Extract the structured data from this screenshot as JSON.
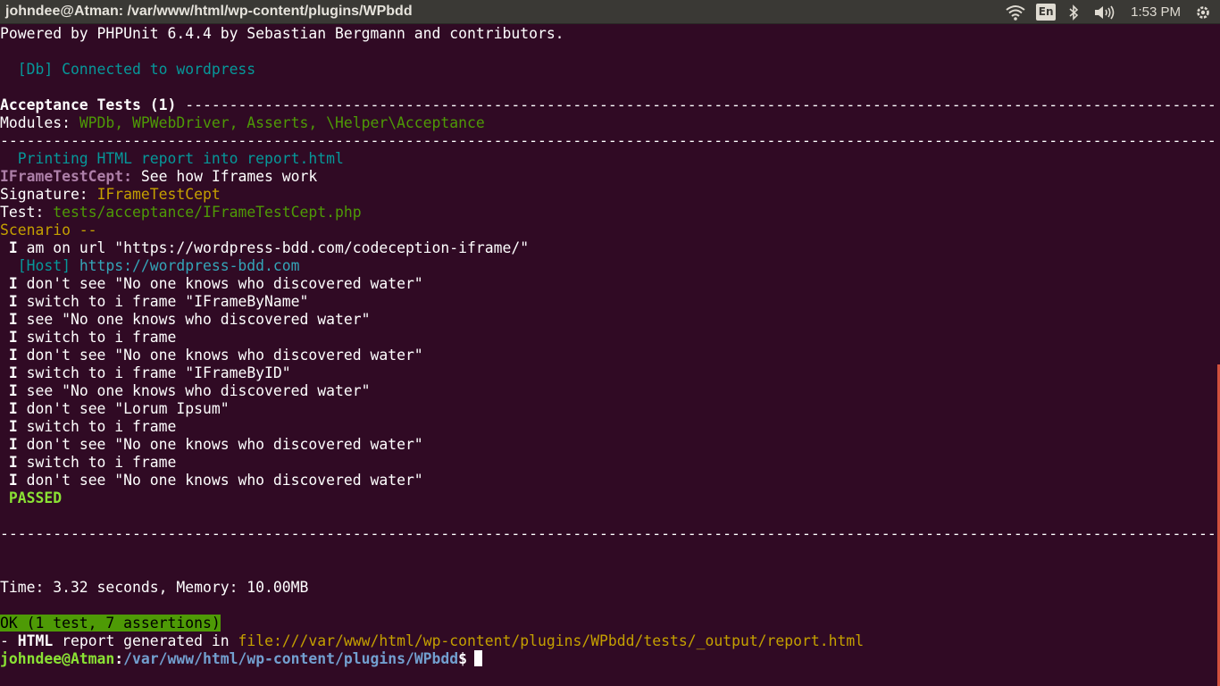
{
  "topbar": {
    "window_title": "johndee@Atman: /var/www/html/wp-content/plugins/WPbdd",
    "lang": "En",
    "clock": "1:53 PM",
    "icons": [
      "wifi-icon",
      "bluetooth-icon",
      "sound-icon",
      "gear-icon"
    ]
  },
  "colors": {
    "terminal_bg": "#300a24",
    "cyan": "#06989a",
    "green": "#4e9a06",
    "bright_green": "#8ae234",
    "yellow": "#c4a000",
    "magenta": "#ad7fa8",
    "link": "#34a5b8",
    "path": "#729fcf"
  },
  "terminal": {
    "powered_by": "Powered by PHPUnit 6.4.4 by Sebastian Bergmann and contributors.",
    "db_connected": "  [Db] Connected to wordpress",
    "suite_header": "Acceptance Tests (1)",
    "suite_rule": " ---------------------------------------------------------------------------------------------------------------------------",
    "modules_label": "Modules: ",
    "modules_value": "WPDb, WPWebDriver, Asserts, \\Helper\\Acceptance",
    "rule": "-------------------------------------------------------------------------------------------------------------------------------------------",
    "printing_report": "  Printing HTML report into report.html",
    "test_name": "IFrameTestCept:",
    "test_desc": " See how Iframes work",
    "signature_label": "Signature: ",
    "signature_value": "IFrameTestCept",
    "test_label": "Test: ",
    "test_value": "tests/acceptance/IFrameTestCept.php",
    "scenario": "Scenario --",
    "host_label": "  [Host] ",
    "host_url": "https://wordpress-bdd.com",
    "steps": [
      " am on url \"https://wordpress-bdd.com/codeception-iframe/\"",
      " don't see \"No one knows who discovered water\"",
      " switch to i frame \"IFrameByName\"",
      " see \"No one knows who discovered water\"",
      " switch to i frame",
      " don't see \"No one knows who discovered water\"",
      " switch to i frame \"IFrameByID\"",
      " see \"No one knows who discovered water\"",
      " don't see \"Lorum Ipsum\"",
      " switch to i frame",
      " don't see \"No one knows who discovered water\"",
      " switch to i frame",
      " don't see \"No one knows who discovered water\""
    ],
    "step_prefix": " I",
    "passed": " PASSED",
    "time_memory": "Time: 3.32 seconds, Memory: 10.00MB",
    "ok_summary": "OK (1 test, 7 assertions)",
    "report_prefix": "- ",
    "report_bold": "HTML",
    "report_mid": " report generated in ",
    "report_path": "file:///var/www/html/wp-content/plugins/WPbdd/tests/_output/report.html",
    "prompt_user": "johndee@Atman",
    "prompt_colon": ":",
    "prompt_path": "/var/www/html/wp-content/plugins/WPbdd",
    "prompt_dollar": "$"
  }
}
